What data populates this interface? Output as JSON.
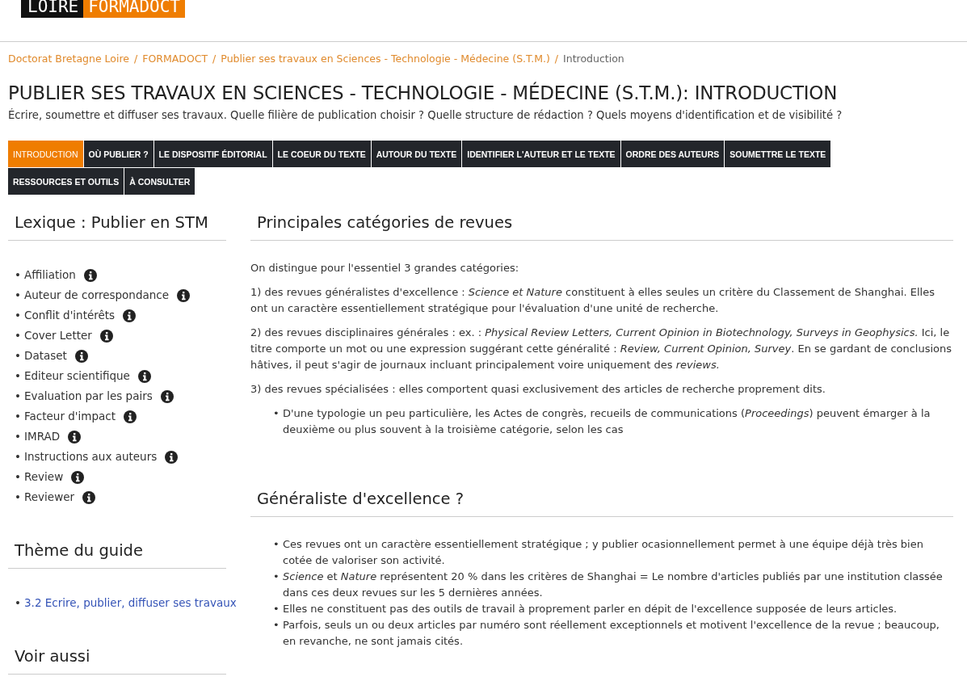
{
  "logo": {
    "left": "LOIRE",
    "right": "FORMADOCT"
  },
  "breadcrumb": {
    "links": [
      "Doctorat Bretagne Loire",
      "FORMADOCT",
      "Publier ses travaux en Sciences - Technologie - Médecine (S.T.M.)"
    ],
    "separator": "/",
    "current": "Introduction"
  },
  "title": "PUBLIER SES TRAVAUX EN SCIENCES - TECHNOLOGIE - MÉDECINE (S.T.M.): INTRODUCTION",
  "subtitle": "Écrire, soumettre et diffuser ses travaux. Quelle filière de publication choisir ? Quelle structure de rédaction ? Quels moyens d'identification et de visibilité ?",
  "tabs": [
    {
      "label": "INTRODUCTION",
      "selected": true
    },
    {
      "label": "OÙ PUBLIER ?",
      "selected": false
    },
    {
      "label": "LE DISPOSITIF ÉDITORIAL",
      "selected": false
    },
    {
      "label": "LE COEUR DU TEXTE",
      "selected": false
    },
    {
      "label": "AUTOUR DU TEXTE",
      "selected": false
    },
    {
      "label": "IDENTIFIER L'AUTEUR ET LE TEXTE",
      "selected": false
    },
    {
      "label": "ORDRE DES AUTEURS",
      "selected": false
    },
    {
      "label": "SOUMETTRE LE TEXTE",
      "selected": false
    },
    {
      "label": "RESSOURCES ET OUTILS",
      "selected": false
    },
    {
      "label": "À CONSULTER",
      "selected": false
    }
  ],
  "sidebar": {
    "sections": [
      {
        "title": "Lexique : Publier en STM",
        "kind": "glossary",
        "items": [
          "Affiliation",
          "Auteur de correspondance",
          "Conflit d'intérêts",
          "Cover Letter",
          "Dataset",
          "Editeur scientifique",
          "Evaluation par les pairs",
          "Facteur d'impact",
          "IMRAD",
          "Instructions aux auteurs",
          "Review",
          "Reviewer"
        ]
      },
      {
        "title": "Thème du guide",
        "kind": "links",
        "items": [
          "3.2 Ecrire, publier, diffuser ses travaux"
        ]
      },
      {
        "title": "Voir aussi"
      }
    ]
  },
  "bullet": "•",
  "content": {
    "sections": [
      {
        "title": "Principales catégories de revues",
        "blocks": [
          {
            "kind": "paragraph",
            "text": "On distingue pour l'essentiel 3 grandes catégories:"
          },
          {
            "kind": "paragraph",
            "text": "1) des revues généralistes d'excellence : *Science et Nature* constituent à elles seules un critère du Classement de Shanghai. Elles ont un caractère essentiellement stratégique pour l'évaluation d'une unité de recherche."
          },
          {
            "kind": "paragraph",
            "text": "2) des revues disciplinaires générales : ex. : *Physical Review Letters, Current Opinion in Biotechnology, Surveys in Geophysics.* Ici, le titre comporte un mot ou une expression suggérant cette généralité : *Review, Current Opinion, Survey*. En se gardant de conclusions hâtives, il peut s'agir de journaux incluant principalement voire uniquement des *reviews.*"
          },
          {
            "kind": "paragraph",
            "text": "3) des revues spécialisées : elles comportent quasi exclusivement des articles de recherche proprement dits."
          },
          {
            "kind": "list",
            "items": [
              "D'une typologie un peu particulière, les Actes de congrès, recueils de communications (*Proceedings*) peuvent émarger à la deuxième ou plus souvent à la troisième catégorie, selon les cas"
            ]
          }
        ]
      },
      {
        "title": "Généraliste d'excellence ?",
        "blocks": [
          {
            "kind": "list",
            "items": [
              "Ces revues ont un caractère essentiellement stratégique ; y publier ocasionnellement permet à une équipe déjà très bien cotée de valoriser son activité.",
              "*Science* et *Nature* représentent 20 % dans les critères de Shanghai = Le nombre d'articles publiés par une institution classée dans ces deux revues sur les 5 dernières années.",
              "Elles ne constituent pas des outils de travail à proprement parler en dépit de l'excellence supposée de leurs articles.",
              "Parfois, seuls un ou deux articles par numéro sont réellement exceptionnels et motivent l'excellence de la revue ; beaucoup, en revanche, ne sont jamais cités."
            ]
          }
        ]
      }
    ]
  }
}
